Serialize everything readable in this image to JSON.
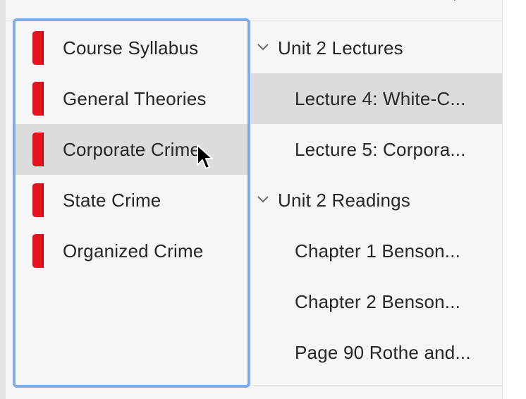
{
  "colors": {
    "tab_red": "#e5141e",
    "focus_ring": "#7fabeb",
    "hover_bg": "#dcdcdc",
    "pane_bg": "#f6f6f6",
    "text": "#262626"
  },
  "courses": {
    "items": [
      {
        "label": "Course Syllabus",
        "icon": "red-tab-icon"
      },
      {
        "label": "General Theories",
        "icon": "red-tab-icon"
      },
      {
        "label": "Corporate Crime",
        "icon": "red-tab-icon"
      },
      {
        "label": "State Crime",
        "icon": "red-tab-icon"
      },
      {
        "label": "Organized Crime",
        "icon": "red-tab-icon"
      }
    ]
  },
  "tree": {
    "groups": [
      {
        "label": "Unit 2 Lectures",
        "icon": "chevron-down-icon",
        "children": [
          {
            "label": "Lecture 4: White-C..."
          },
          {
            "label": "Lecture 5: Corpora..."
          }
        ]
      },
      {
        "label": "Unit 2 Readings",
        "icon": "chevron-down-icon",
        "children": [
          {
            "label": "Chapter 1 Benson..."
          },
          {
            "label": "Chapter 2 Benson..."
          },
          {
            "label": "Page 90 Rothe and..."
          }
        ]
      }
    ]
  }
}
